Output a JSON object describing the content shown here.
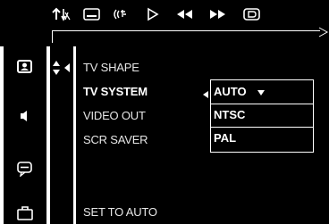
{
  "toolbar": {
    "icons": [
      "sort-audio-icon",
      "subtitle-icon",
      "audio-sound-icon",
      "play-icon",
      "rewind-icon",
      "fast-forward-icon",
      "display-icon"
    ]
  },
  "sidebar": {
    "icons": [
      "picture-setup-icon",
      "speaker-icon",
      "chat-bubble-icon",
      "briefcase-icon"
    ]
  },
  "menu": {
    "items": [
      {
        "label": "TV SHAPE",
        "bold": false
      },
      {
        "label": "TV SYSTEM",
        "bold": true
      },
      {
        "label": "VIDEO OUT",
        "bold": false
      },
      {
        "label": "SCR SAVER",
        "bold": false
      }
    ],
    "footer": "SET TO AUTO"
  },
  "dropdown": {
    "selected": "AUTO",
    "options": [
      "AUTO",
      "NTSC",
      "PAL"
    ]
  },
  "colors": {
    "background": "#000000",
    "foreground": "#ffffff"
  }
}
